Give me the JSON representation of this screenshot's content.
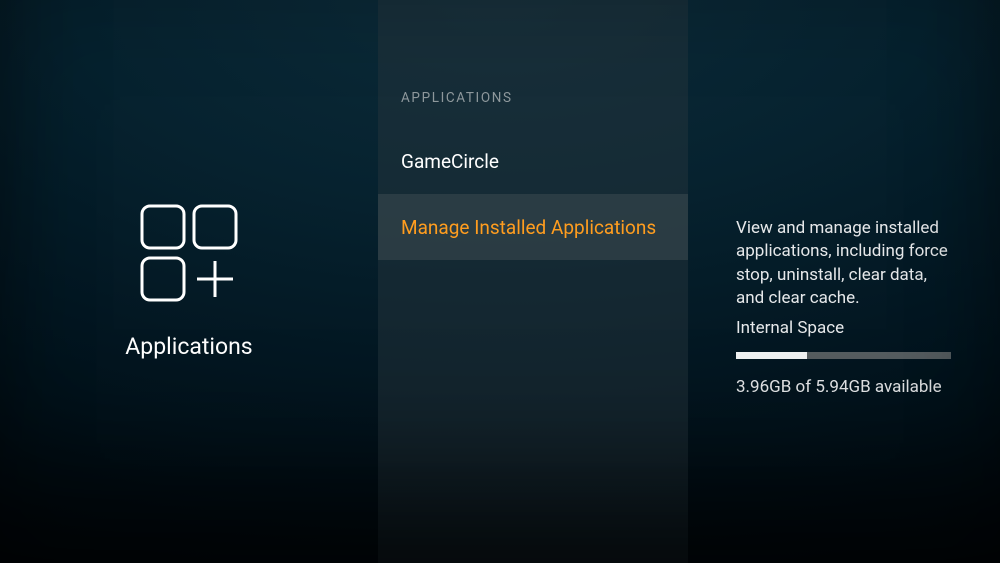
{
  "left": {
    "title": "Applications"
  },
  "middle": {
    "section_header": "APPLICATIONS",
    "items": [
      {
        "label": "GameCircle"
      },
      {
        "label": "Manage Installed Applications"
      }
    ]
  },
  "detail": {
    "description": "View and manage installed applications, including force stop, uninstall, clear data, and clear cache.",
    "storage_label": "Internal Space",
    "storage_used_gb": 1.98,
    "storage_total_gb": 5.94,
    "storage_text": "3.96GB of 5.94GB available"
  },
  "progress_percent": 33
}
